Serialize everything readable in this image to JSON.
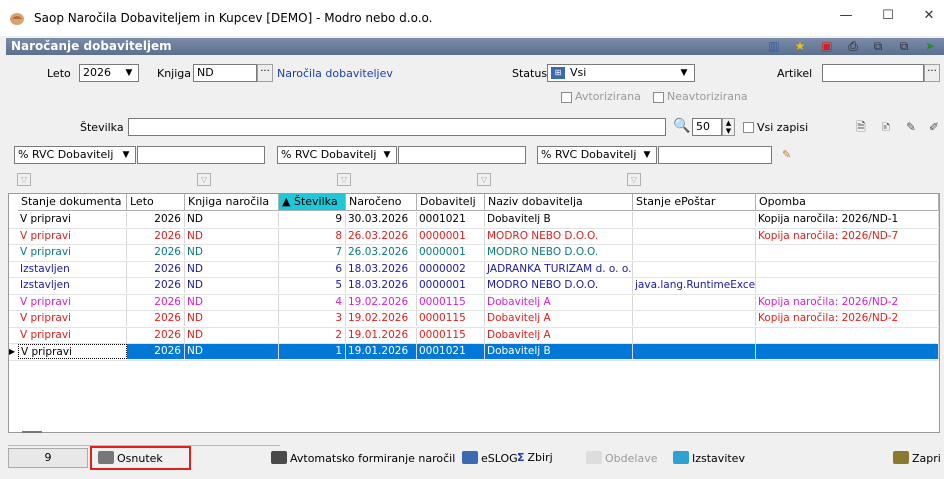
{
  "window": {
    "title": "Saop  Naročila Dobaviteljem in Kupcev [DEMO] - Modro nebo d.o.o.",
    "minimize": "—",
    "maximize": "☐",
    "close": "✕"
  },
  "panel": {
    "title": "Naročanje dobaviteljem"
  },
  "filters": {
    "leto_label": "Leto",
    "leto_value": "2026",
    "knjiga_label": "Knjiga",
    "knjiga_value": "ND",
    "knjiga_desc": "Naročila dobaviteljev",
    "status_label": "Status",
    "status_value": "Vsi",
    "artikel_label": "Artikel",
    "artikel_value": "",
    "avtorizirana": "Avtorizirana",
    "neavtorizirana": "Neavtorizirana",
    "stevilka_label": "Številka",
    "stevilka_value": "",
    "limit_value": "50",
    "vsi_zapisi": "Vsi zapisi",
    "rvc1": "% RVC Dobavitelj",
    "rvc2": "% RVC Dobavitelj",
    "rvc3": "% RVC Dobavitelj"
  },
  "grid": {
    "columns": [
      "Stanje dokumenta",
      "Leto",
      "Knjiga naročila",
      "▲ Številka",
      "Naročeno",
      "Dobavitelj",
      "Naziv dobavitelja",
      "Stanje ePoštar",
      "Opomba"
    ],
    "rows": [
      {
        "stanje": "V pripravi",
        "leto": "2026",
        "knjiga": "ND",
        "st": "9",
        "datum": "30.03.2026",
        "dob": "0001021",
        "naziv": "Dobavitelj B",
        "eps": "",
        "opomba": "Kopija naročila: 2026/ND-1",
        "color": "#000000"
      },
      {
        "stanje": "V pripravi",
        "leto": "2026",
        "knjiga": "ND",
        "st": "8",
        "datum": "26.03.2026",
        "dob": "0000001",
        "naziv": "MODRO NEBO D.O.O.",
        "eps": "",
        "opomba": "Kopija naročila: 2026/ND-7",
        "color": "#e0201c"
      },
      {
        "stanje": "V pripravi",
        "leto": "2026",
        "knjiga": "ND",
        "st": "7",
        "datum": "26.03.2026",
        "dob": "0000001",
        "naziv": "MODRO NEBO D.O.O.",
        "eps": "",
        "opomba": "",
        "color": "#0a7a7a"
      },
      {
        "stanje": "Izstavljen",
        "leto": "2026",
        "knjiga": "ND",
        "st": "6",
        "datum": "18.03.2026",
        "dob": "0000002",
        "naziv": "JADRANKA TURIZAM d. o. o.",
        "eps": "",
        "opomba": "",
        "color": "#1a1aa8"
      },
      {
        "stanje": "Izstavljen",
        "leto": "2026",
        "knjiga": "ND",
        "st": "5",
        "datum": "18.03.2026",
        "dob": "0000001",
        "naziv": "MODRO NEBO D.O.O.",
        "eps": "java.lang.RuntimeExcepti",
        "opomba": "",
        "color": "#1a1aa8"
      },
      {
        "stanje": "V pripravi",
        "leto": "2026",
        "knjiga": "ND",
        "st": "4",
        "datum": "19.02.2026",
        "dob": "0000115",
        "naziv": "Dobavitelj A",
        "eps": "",
        "opomba": "Kopija naročila: 2026/ND-2",
        "color": "#d21fd2"
      },
      {
        "stanje": "V pripravi",
        "leto": "2026",
        "knjiga": "ND",
        "st": "3",
        "datum": "19.02.2026",
        "dob": "0000115",
        "naziv": "Dobavitelj A",
        "eps": "",
        "opomba": "Kopija naročila: 2026/ND-2",
        "color": "#e0201c"
      },
      {
        "stanje": "V pripravi",
        "leto": "2026",
        "knjiga": "ND",
        "st": "2",
        "datum": "19.01.2026",
        "dob": "0000115",
        "naziv": "Dobavitelj A",
        "eps": "",
        "opomba": "",
        "color": "#e0201c"
      },
      {
        "stanje": "V pripravi",
        "leto": "2026",
        "knjiga": "ND",
        "st": "1",
        "datum": "19.01.2026",
        "dob": "0001021",
        "naziv": "Dobavitelj B",
        "eps": "",
        "opomba": "",
        "color": "#000000"
      }
    ]
  },
  "bottom": {
    "count": "9",
    "osnutek": "Osnutek",
    "avtomatsko": "Avtomatsko formiranje naročil",
    "eslog": "eSLOG",
    "zbiri": "Zbirj",
    "obdelave": "Obdelave",
    "izstavitev": "Izstavitev",
    "zapri": "Zapri"
  },
  "colors": {
    "selected_row": "#0078d7",
    "highlight_box": "#e0201c",
    "header_bg": "#5b6f8f"
  }
}
